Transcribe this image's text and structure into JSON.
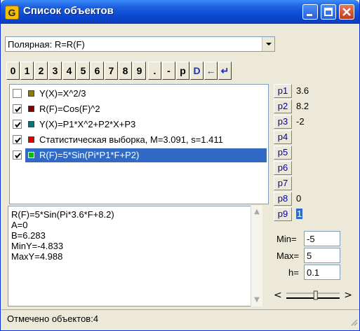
{
  "window": {
    "title": "Список объектов",
    "icon_letter": "G"
  },
  "mode_select": {
    "value": "Полярная: R=R(F)"
  },
  "keypad": {
    "keys": [
      "0",
      "1",
      "2",
      "3",
      "4",
      "5",
      "6",
      "7",
      "8",
      "9",
      ".",
      "-",
      "p",
      "D",
      "←",
      "↵"
    ]
  },
  "objects": [
    {
      "checked": false,
      "color": "#8b7d00",
      "label": "Y(X)=X^2/3",
      "selected": false
    },
    {
      "checked": true,
      "color": "#800000",
      "label": "R(F)=Cos(F)^2",
      "selected": false
    },
    {
      "checked": true,
      "color": "#007878",
      "label": "Y(X)=P1*X^2+P2*X+P3",
      "selected": false
    },
    {
      "checked": true,
      "color": "#e00000",
      "label": "Статистическая выборка, M=3.091, s=1.411",
      "selected": false
    },
    {
      "checked": true,
      "color": "#00c000",
      "label": "R(F)=5*Sin(Pi*P1*F+P2)",
      "selected": true
    }
  ],
  "info": {
    "lines": [
      "R(F)=5*Sin(Pi*3.6*F+8.2)",
      "A=0",
      "B=6.283",
      "MinY=-4.833",
      "MaxY=4.988"
    ]
  },
  "params": [
    {
      "name": "p1",
      "value": "3.6"
    },
    {
      "name": "p2",
      "value": "8.2"
    },
    {
      "name": "p3",
      "value": "-2"
    },
    {
      "name": "p4",
      "value": ""
    },
    {
      "name": "p5",
      "value": ""
    },
    {
      "name": "p6",
      "value": ""
    },
    {
      "name": "p7",
      "value": ""
    },
    {
      "name": "p8",
      "value": "0"
    },
    {
      "name": "p9",
      "value": "1"
    }
  ],
  "range": {
    "min_label": "Min=",
    "min_value": "-5",
    "max_label": "Max=",
    "max_value": "5",
    "h_label": "h=",
    "h_value": "0.1"
  },
  "slider": {
    "left_arrow": "<",
    "right_arrow": ">",
    "position": 0.55
  },
  "status": {
    "text": "Отмечено объектов:4"
  }
}
